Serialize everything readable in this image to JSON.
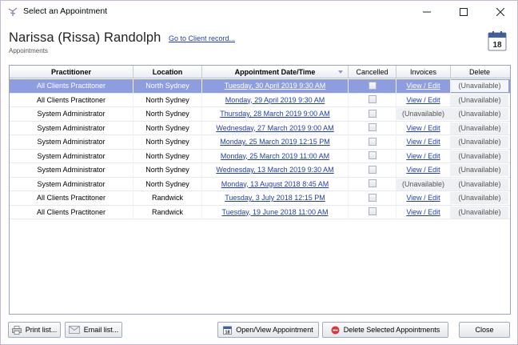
{
  "window": {
    "title": "Select an Appointment",
    "minimize": "–",
    "maximize": "☐",
    "close": "✕"
  },
  "header": {
    "client_name": "Narissa (Rissa) Randolph",
    "client_link": "Go to Client record...",
    "subtitle": "Appointments",
    "calendar_day": "18"
  },
  "grid": {
    "columns": [
      "Practitioner",
      "Location",
      "Appointment Date/Time",
      "Cancelled",
      "Invoices",
      "Delete"
    ],
    "rows": [
      {
        "practitioner": "All Clients Practitoner",
        "location": "North Sydney",
        "datetime": "Tuesday, 30 April 2019 9:30 AM",
        "invoice": "View / Edit",
        "delete": "(Unavailable)"
      },
      {
        "practitioner": "All Clients Practitoner",
        "location": "North Sydney",
        "datetime": "Monday, 29 April 2019 9:30 AM",
        "invoice": "View / Edit",
        "delete": "(Unavailable)"
      },
      {
        "practitioner": "System Administrator",
        "location": "North Sydney",
        "datetime": "Thursday, 28 March 2019 9:00 AM",
        "invoice": "(Unavailable)",
        "delete": "(Unavailable)"
      },
      {
        "practitioner": "System Administrator",
        "location": "North Sydney",
        "datetime": "Wednesday, 27 March 2019 9:00 AM",
        "invoice": "View / Edit",
        "delete": "(Unavailable)"
      },
      {
        "practitioner": "System Administrator",
        "location": "North Sydney",
        "datetime": "Monday, 25 March 2019 12:15 PM",
        "invoice": "View / Edit",
        "delete": "(Unavailable)"
      },
      {
        "practitioner": "System Administrator",
        "location": "North Sydney",
        "datetime": "Monday, 25 March 2019 11:00 AM",
        "invoice": "View / Edit",
        "delete": "(Unavailable)"
      },
      {
        "practitioner": "System Administrator",
        "location": "North Sydney",
        "datetime": "Wednesday, 13 March 2019 9:30 AM",
        "invoice": "View / Edit",
        "delete": "(Unavailable)"
      },
      {
        "practitioner": "System Administrator",
        "location": "North Sydney",
        "datetime": "Monday, 13 August 2018 8:45 AM",
        "invoice": "(Unavailable)",
        "delete": "(Unavailable)"
      },
      {
        "practitioner": "All Clients Practitoner",
        "location": "Randwick",
        "datetime": "Tuesday, 3 July 2018 12:15 PM",
        "invoice": "View / Edit",
        "delete": "(Unavailable)"
      },
      {
        "practitioner": "All Clients Practitoner",
        "location": "Randwick",
        "datetime": "Tuesday, 19 June 2018 11:00 AM",
        "invoice": "View / Edit",
        "delete": "(Unavailable)"
      }
    ]
  },
  "buttons": {
    "print": "Print list...",
    "email": "Email list...",
    "open": "Open/View Appointment",
    "delete": "Delete Selected Appointments",
    "close": "Close"
  },
  "colors": {
    "selection": "#8d9de0",
    "link": "#1f3fa8"
  }
}
